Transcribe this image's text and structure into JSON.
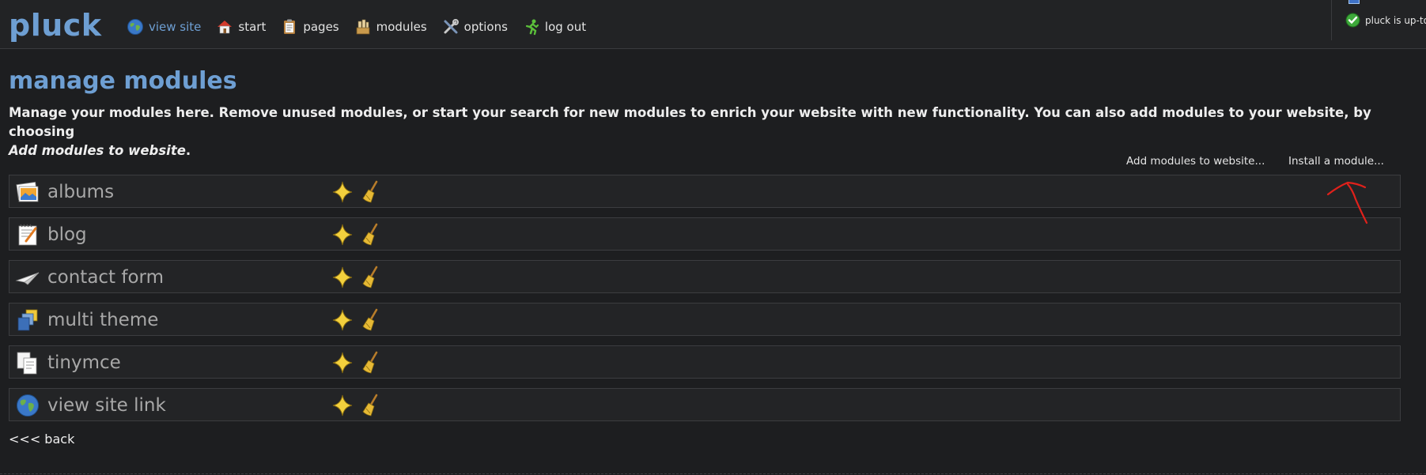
{
  "header": {
    "logo": "pluck",
    "nav": [
      {
        "label": "view site",
        "icon": "globe-icon"
      },
      {
        "label": "start",
        "icon": "house-icon"
      },
      {
        "label": "pages",
        "icon": "clipboard-icon"
      },
      {
        "label": "modules",
        "icon": "modules-icon"
      },
      {
        "label": "options",
        "icon": "tools-icon"
      },
      {
        "label": "log out",
        "icon": "running-man-icon"
      }
    ],
    "update_status": "pluck is up-to-"
  },
  "main": {
    "title": "manage modules",
    "intro_text": "Manage your modules here. Remove unused modules, or start your search for new modules to enrich your website with new functionality. You can also add modules to your website, by choosing",
    "intro_emphasis": "Add modules to website",
    "intro_end": ".",
    "actions": {
      "add_modules": "Add modules to website...",
      "install_module": "Install a module..."
    },
    "modules": [
      {
        "name": "albums",
        "icon": "albums-icon"
      },
      {
        "name": "blog",
        "icon": "blog-icon"
      },
      {
        "name": "contact form",
        "icon": "paper-plane-icon"
      },
      {
        "name": "multi theme",
        "icon": "multi-theme-icon"
      },
      {
        "name": "tinymce",
        "icon": "tinymce-icon"
      },
      {
        "name": "view site link",
        "icon": "globe-icon"
      }
    ],
    "back_link": "<<< back"
  },
  "colors": {
    "accent": "#6e9fd3",
    "background": "#1d1e20",
    "row_background": "#232426",
    "annotation": "#e0211b"
  }
}
